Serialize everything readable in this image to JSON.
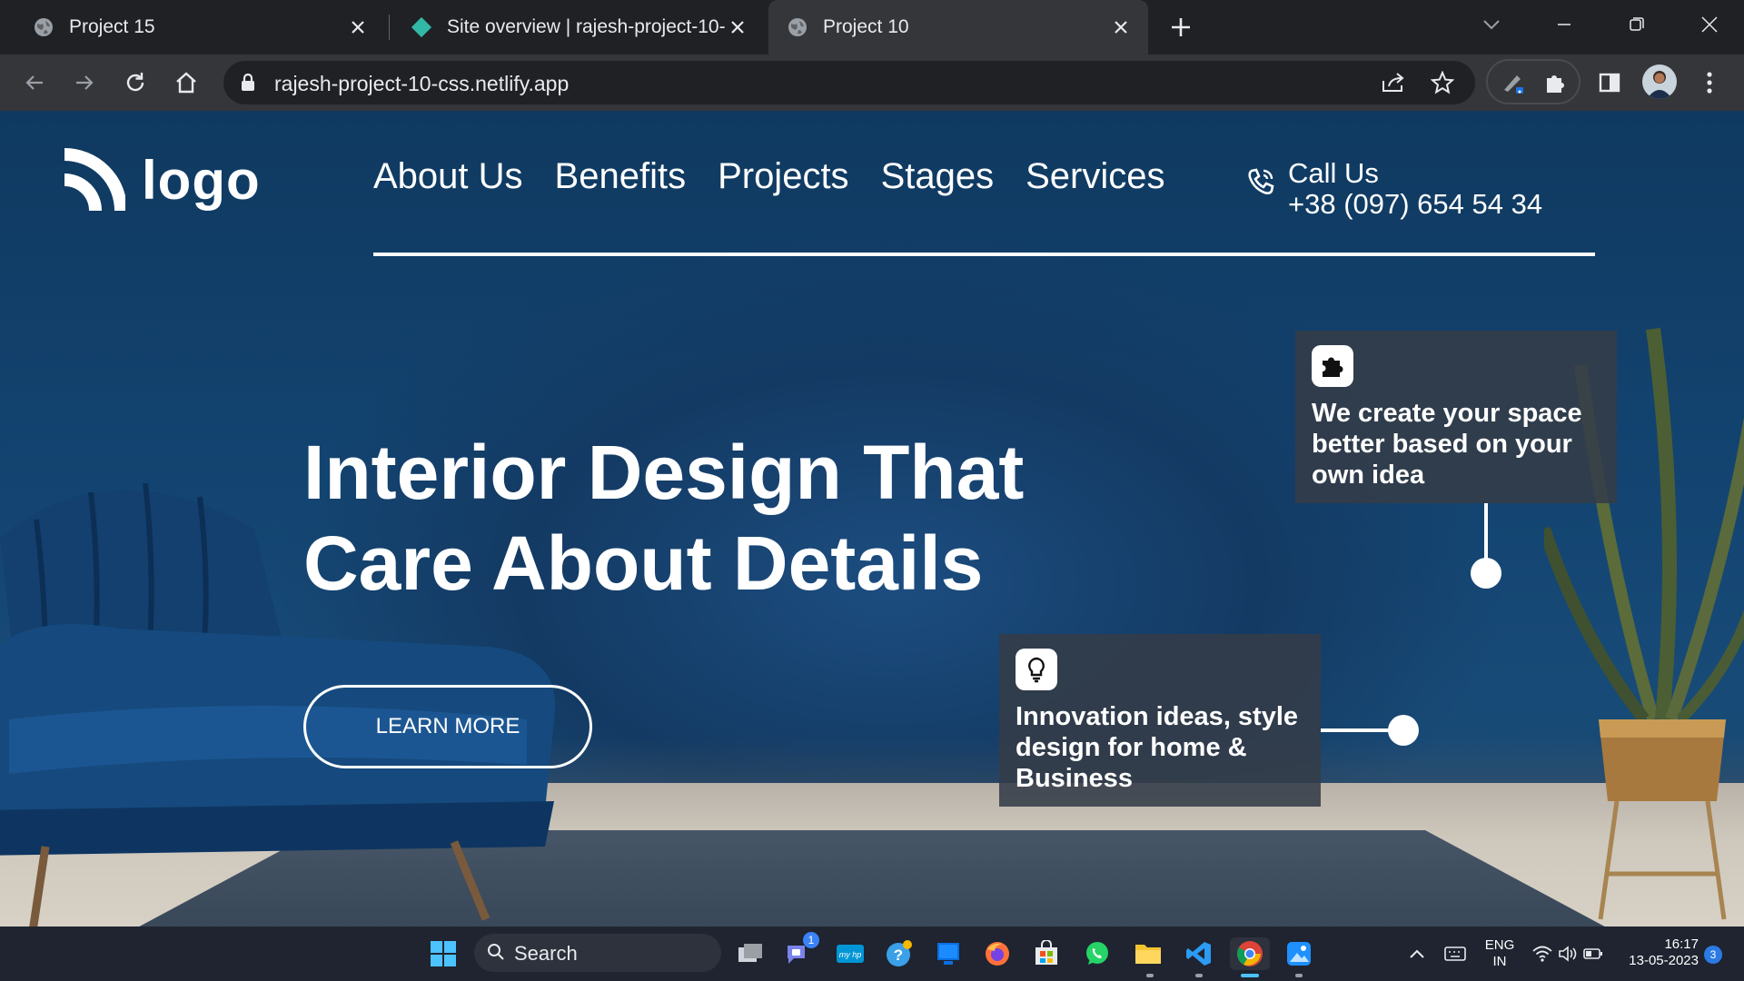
{
  "browser": {
    "tabs": [
      {
        "title": "Project 15",
        "active": false
      },
      {
        "title": "Site overview | rajesh-project-10-",
        "active": false
      },
      {
        "title": "Project 10",
        "active": true
      }
    ],
    "url": "rajesh-project-10-css.netlify.app"
  },
  "site": {
    "logo_text": "logo",
    "nav": [
      "About Us",
      "Benefits",
      "Projects",
      "Stages",
      "Services"
    ],
    "call_label": "Call Us",
    "call_number": "+38 (097) 654 54 34",
    "hero_title_line1": "Interior Design That",
    "hero_title_line2": "Care About Details",
    "cta_label": "LEARN MORE",
    "cards": [
      {
        "icon": "puzzle-icon",
        "text": "We create your space better based on your own idea"
      },
      {
        "icon": "lightbulb-icon",
        "text": "Innovation ideas, style design for home & Business"
      }
    ]
  },
  "taskbar": {
    "search_label": "Search",
    "language": "ENG",
    "region": "IN",
    "time": "16:17",
    "date": "13-05-2023",
    "notification_count": "3",
    "teams_badge": "1"
  },
  "colors": {
    "tab_strip": "#202124",
    "toolbar": "#35363a",
    "hero_blue": "#134471",
    "card_bg": "#343c48",
    "taskbar": "#1f2430"
  }
}
